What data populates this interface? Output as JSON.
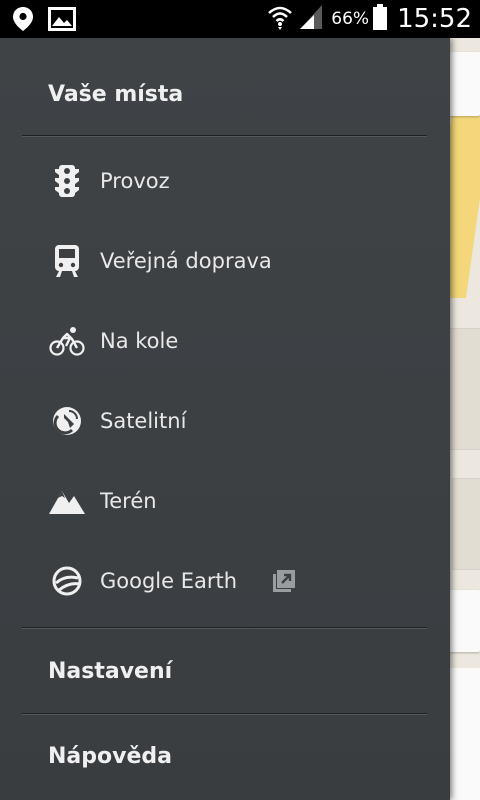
{
  "status_bar": {
    "battery_percent": "66%",
    "time": "15:52"
  },
  "drawer": {
    "your_places": "Vaše místa",
    "layers": [
      {
        "label": "Provoz",
        "icon": "traffic-light-icon"
      },
      {
        "label": "Veřejná doprava",
        "icon": "bus-icon"
      },
      {
        "label": "Na kole",
        "icon": "bicycle-icon"
      },
      {
        "label": "Satelitní",
        "icon": "satellite-icon"
      },
      {
        "label": "Terén",
        "icon": "mountain-icon"
      },
      {
        "label": "Google Earth",
        "icon": "google-earth-icon",
        "external": true
      }
    ],
    "settings": "Nastavení",
    "help": "Nápověda"
  },
  "colors": {
    "drawer_bg": "#3c4043",
    "status_bar_bg": "#000000",
    "text": "#ececec"
  }
}
